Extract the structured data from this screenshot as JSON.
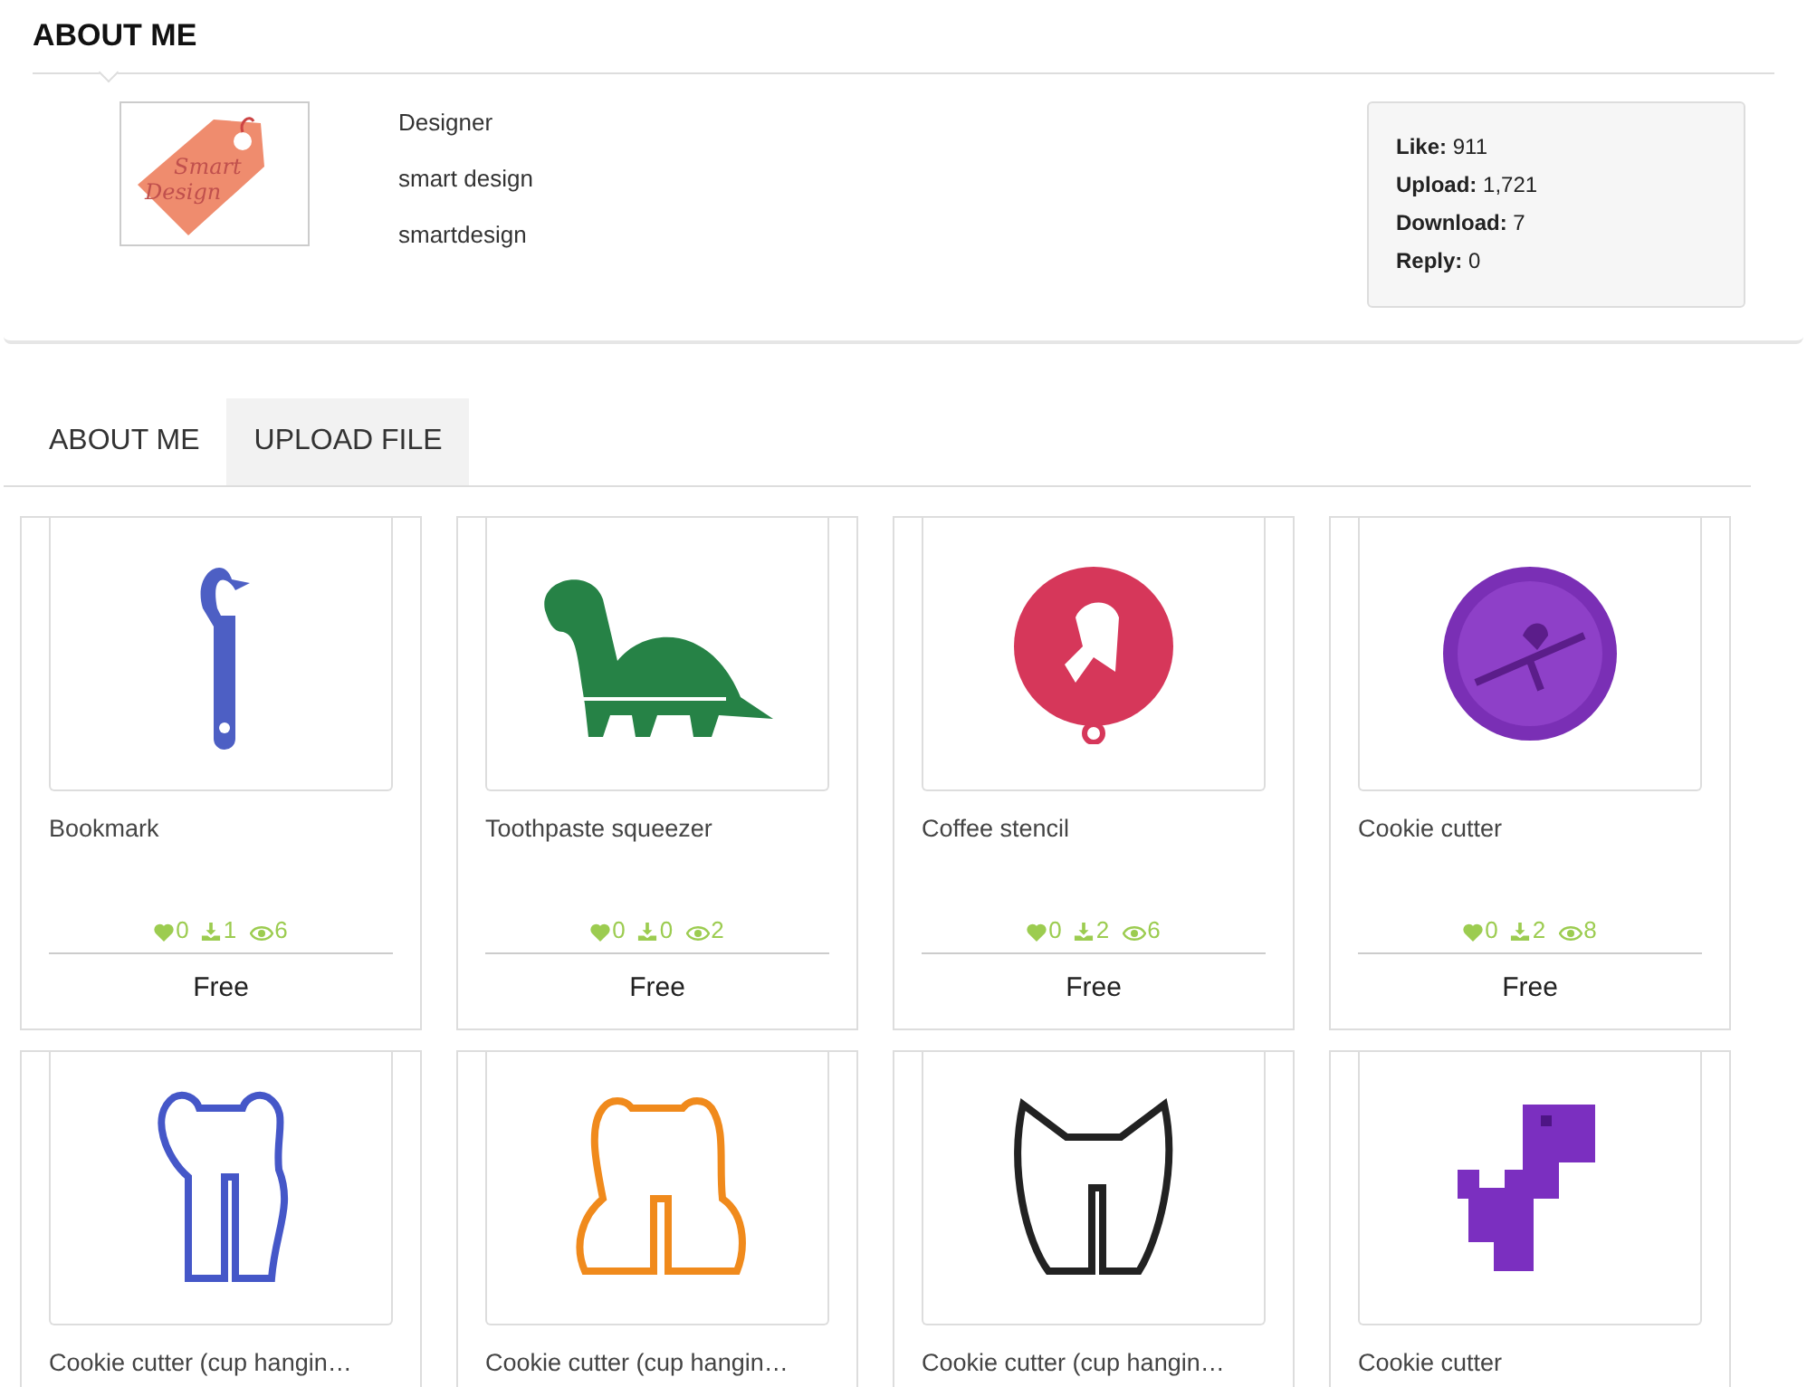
{
  "about": {
    "title": "ABOUT ME",
    "info": [
      "Designer",
      "smart design",
      "smartdesign"
    ],
    "logo_text": [
      "Smart",
      "Design"
    ],
    "stats": [
      {
        "label": "Like:",
        "value": "911"
      },
      {
        "label": "Upload:",
        "value": "1,721"
      },
      {
        "label": "Download:",
        "value": "7"
      },
      {
        "label": "Reply:",
        "value": "0"
      }
    ]
  },
  "tabs": [
    {
      "label": "ABOUT ME",
      "selected": false
    },
    {
      "label": "UPLOAD FILE",
      "selected": true
    }
  ],
  "items": [
    {
      "title": "Bookmark",
      "likes": "0",
      "downloads": "1",
      "views": "6",
      "price": "Free"
    },
    {
      "title": "Toothpaste squeezer",
      "likes": "0",
      "downloads": "0",
      "views": "2",
      "price": "Free"
    },
    {
      "title": "Coffee stencil",
      "likes": "0",
      "downloads": "2",
      "views": "6",
      "price": "Free"
    },
    {
      "title": "Cookie cutter",
      "likes": "0",
      "downloads": "2",
      "views": "8",
      "price": "Free"
    },
    {
      "title": "Cookie cutter (cup hangin…"
    },
    {
      "title": "Cookie cutter (cup hangin…"
    },
    {
      "title": "Cookie cutter (cup hangin…"
    },
    {
      "title": "Cookie cutter"
    }
  ]
}
